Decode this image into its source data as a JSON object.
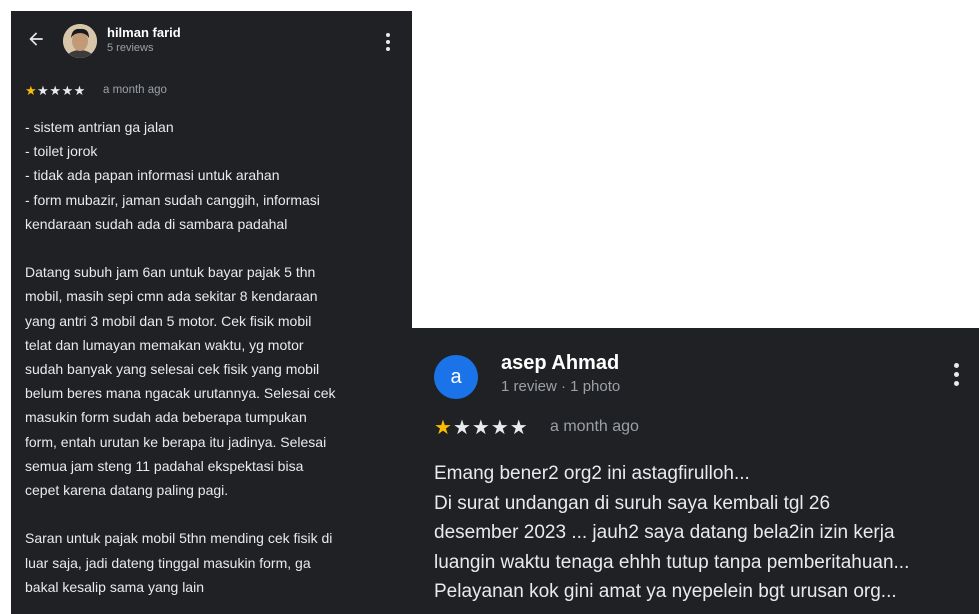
{
  "left_review": {
    "user_name": "hilman farid",
    "user_meta": "5 reviews",
    "rating": 1,
    "time": "a month ago",
    "lines": [
      "- sistem antrian ga jalan",
      "- toilet jorok",
      "- tidak ada papan informasi untuk arahan",
      "- form mubazir, jaman sudah canggih, informasi",
      "kendaraan sudah ada di sambara padahal"
    ],
    "para2": [
      "Datang subuh jam 6an untuk bayar pajak 5 thn",
      "mobil, masih sepi cmn ada sekitar 8 kendaraan",
      "yang antri 3 mobil dan 5 motor. Cek fisik mobil",
      "telat dan lumayan memakan waktu, yg motor",
      "sudah banyak yang selesai cek fisik yang mobil",
      "belum beres mana ngacak urutannya. Selesai cek",
      "masukin form sudah ada beberapa tumpukan",
      "form, entah urutan ke berapa itu jadinya. Selesai",
      "semua jam steng 11 padahal ekspektasi bisa",
      "cepet karena datang paling pagi."
    ],
    "para3": [
      "Saran untuk pajak mobil 5thn mending cek fisik di",
      "luar saja, jadi dateng tinggal masukin form, ga",
      "bakal kesalip sama yang lain"
    ]
  },
  "right_review": {
    "avatar_letter": "a",
    "user_name": "asep Ahmad",
    "user_meta": "1 review · 1 photo",
    "rating": 1,
    "time": "a month ago",
    "lines": [
      "Emang bener2 org2 ini astagfirulloh...",
      "Di surat undangan di suruh saya kembali tgl 26",
      "desember 2023 ... jauh2 saya datang bela2in izin kerja",
      "luangin waktu tenaga ehhh tutup tanpa pemberitahuan...",
      "Pelayanan kok gini amat ya nyepelein bgt urusan org..."
    ]
  },
  "colors": {
    "card_bg": "#202124",
    "star_filled": "#fbbc04",
    "avatar_blue": "#1a73e8",
    "secondary_text": "#9aa0a6"
  },
  "icons": [
    "back-arrow-icon",
    "more-vert-icon",
    "star-icon"
  ]
}
